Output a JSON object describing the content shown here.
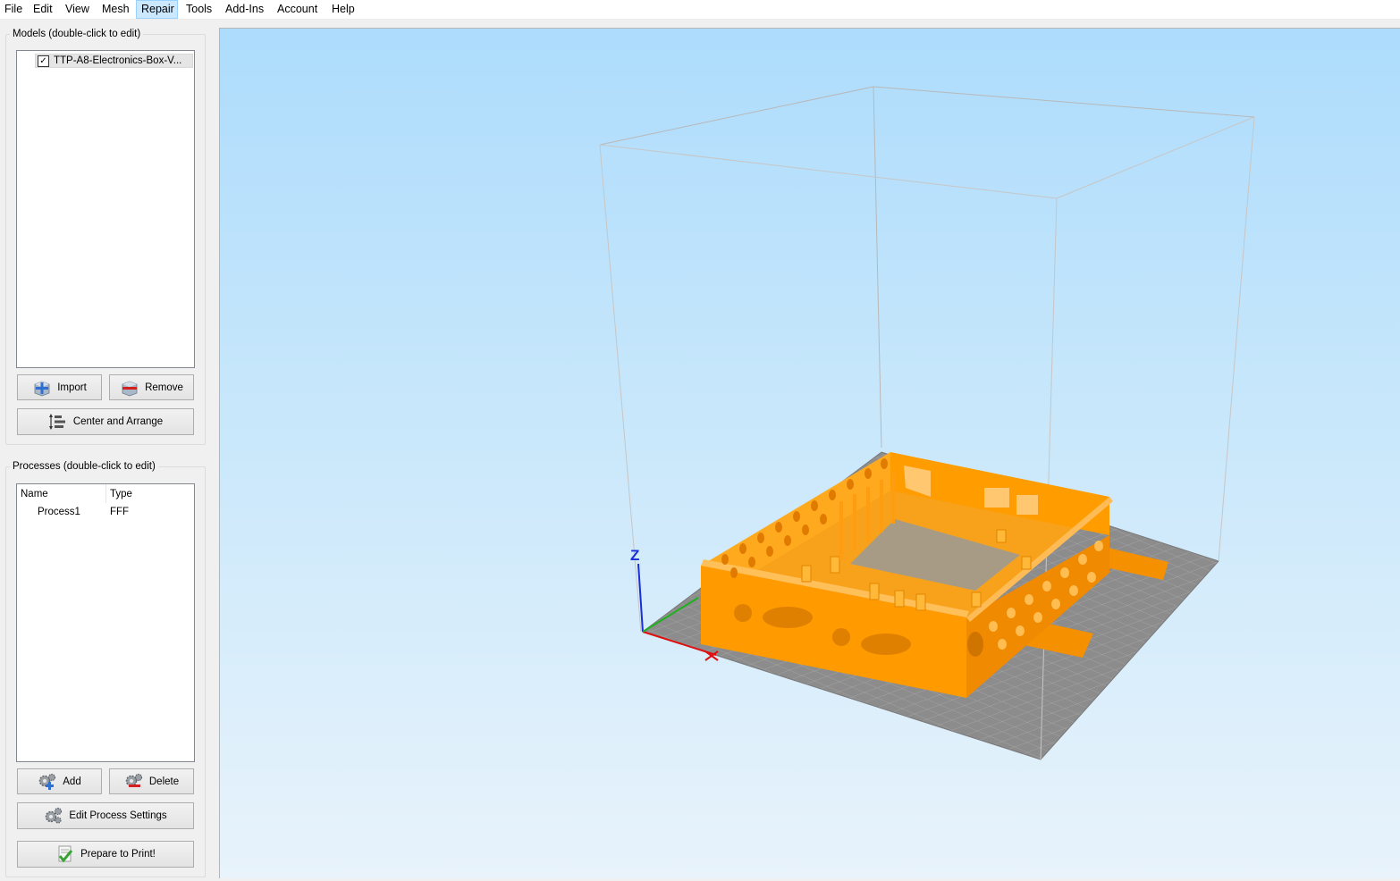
{
  "menu": {
    "items": [
      "File",
      "Edit",
      "View",
      "Mesh",
      "Repair",
      "Tools",
      "Add-Ins",
      "Account",
      "Help"
    ],
    "active": "Repair"
  },
  "models": {
    "title": "Models (double-click to edit)",
    "items": [
      {
        "label": "TTP-A8-Electronics-Box-V...",
        "checked": true
      }
    ],
    "import_label": "Import",
    "remove_label": "Remove",
    "center_label": "Center and Arrange"
  },
  "processes": {
    "title": "Processes (double-click to edit)",
    "columns": [
      "Name",
      "Type"
    ],
    "rows": [
      {
        "name": "Process1",
        "type": "FFF"
      }
    ],
    "add_label": "Add",
    "delete_label": "Delete",
    "edit_label": "Edit Process Settings",
    "prepare_label": "Prepare to Print!"
  },
  "viewport": {
    "axis_z_label": "Z",
    "model_color": "#ff9c00",
    "bed_color": "#8c8c8c"
  },
  "icons": {
    "import": "cube-plus-icon",
    "remove": "cube-minus-icon",
    "center": "arrange-icon",
    "add": "gears-plus-icon",
    "delete": "gears-minus-icon",
    "edit": "gears-icon",
    "prepare": "checklist-icon"
  }
}
